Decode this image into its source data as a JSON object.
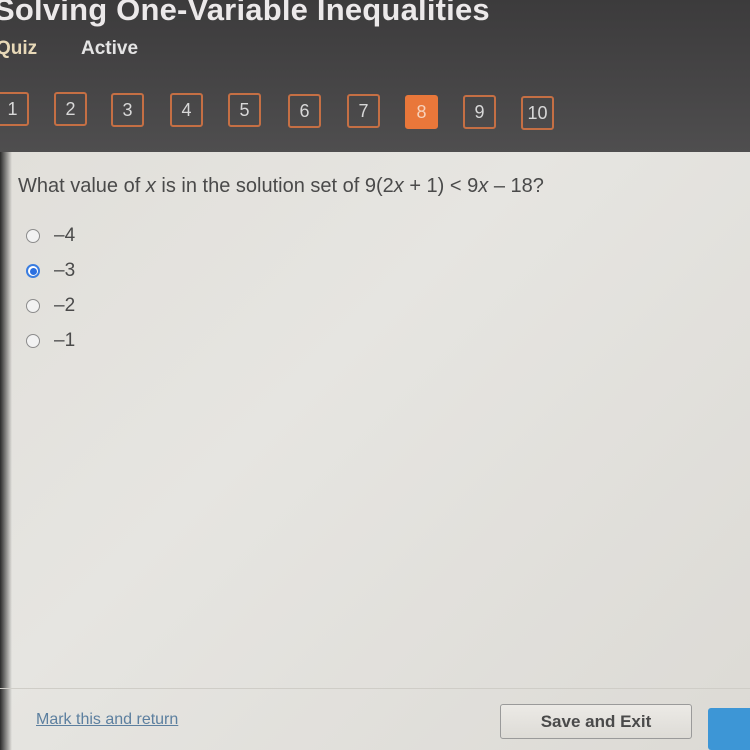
{
  "header": {
    "title": "Solving One-Variable Inequalities",
    "type_label": "Quiz",
    "status_label": "Active"
  },
  "question_nav": {
    "items": [
      "1",
      "2",
      "3",
      "4",
      "5",
      "6",
      "7",
      "8",
      "9",
      "10"
    ],
    "current": "8"
  },
  "question": {
    "prefix": "What value of ",
    "var1": "x",
    "middle": " is in the solution set of 9(2",
    "var2": "x",
    "middle2": " + 1) < 9",
    "var3": "x",
    "suffix": " – 18?"
  },
  "options": [
    {
      "label": "–4",
      "selected": false
    },
    {
      "label": "–3",
      "selected": true
    },
    {
      "label": "–2",
      "selected": false
    },
    {
      "label": "–1",
      "selected": false
    }
  ],
  "footer": {
    "mark_link": "Mark this and return",
    "save_button": "Save and Exit"
  },
  "colors": {
    "accent": "#e9773a",
    "selected_radio": "#2a6fe0",
    "next_button": "#3d96d6"
  }
}
